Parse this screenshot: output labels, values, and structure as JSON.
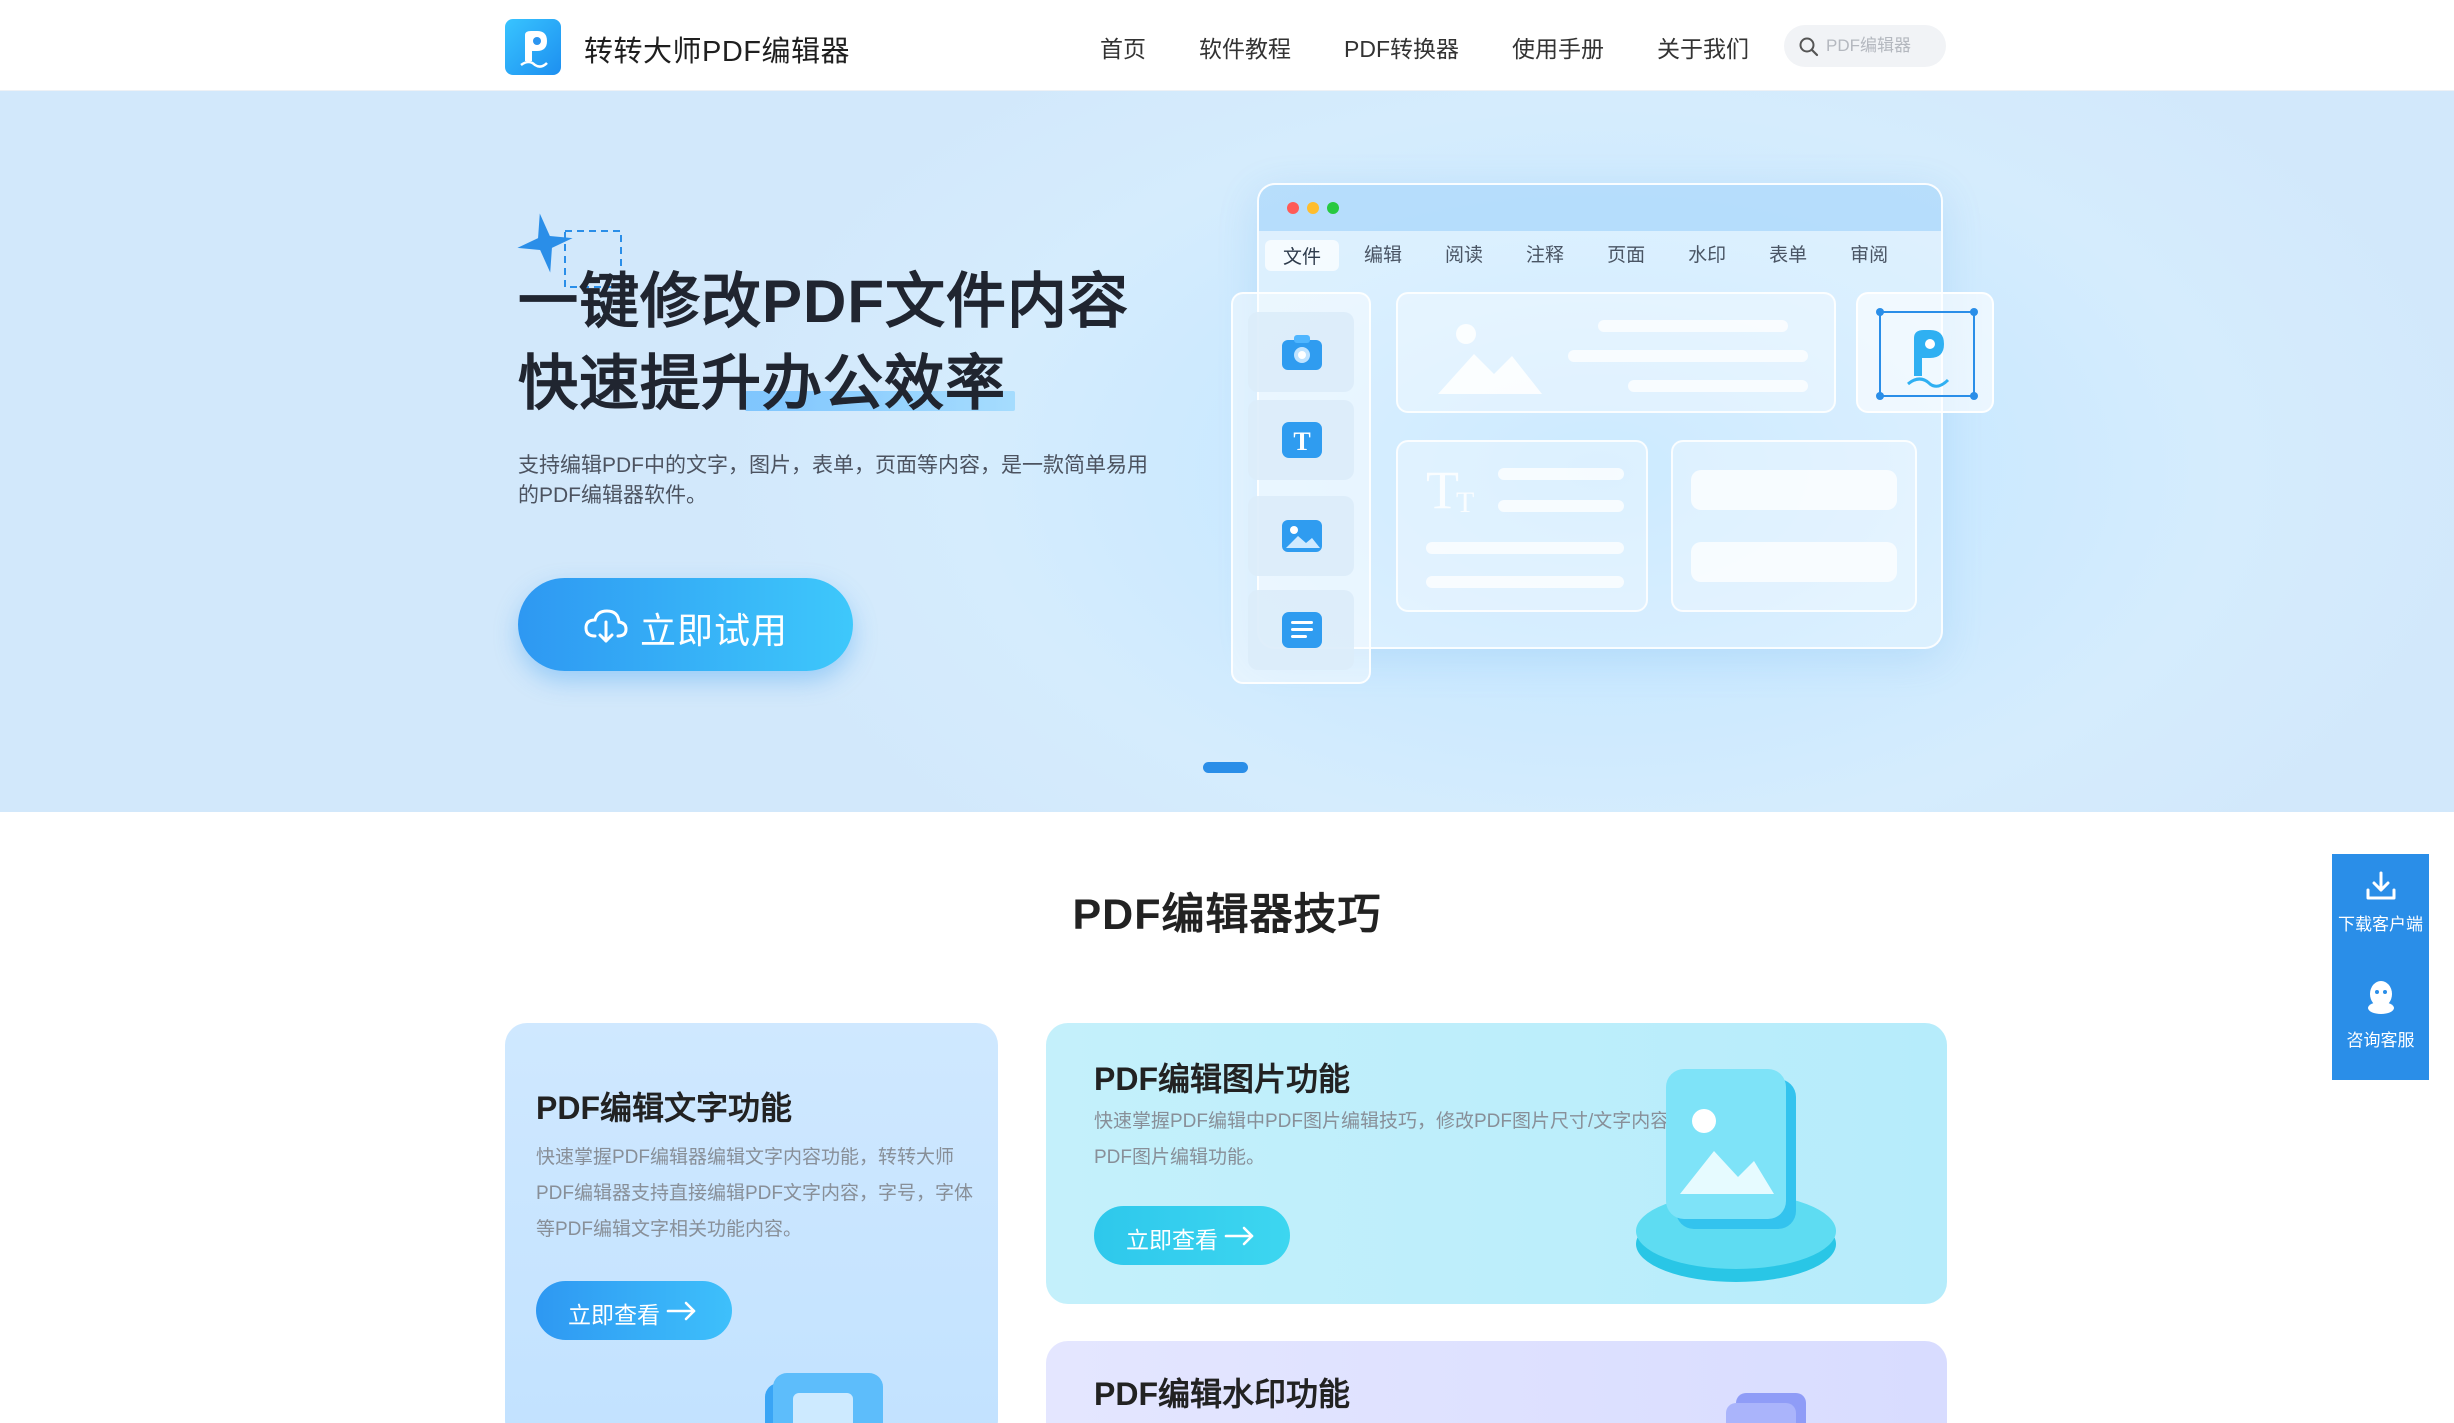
{
  "nav": {
    "brand": "转转大师PDF编辑器",
    "links": [
      "首页",
      "软件教程",
      "PDF转换器",
      "使用手册",
      "关于我们"
    ],
    "search_placeholder": "PDF编辑器"
  },
  "hero": {
    "title_line1": "一键修改PDF文件内容",
    "title_line2": "快速提升办公效率",
    "description": "支持编辑PDF中的文字，图片，表单，页面等内容，是一款简单易用的PDF编辑器软件。",
    "cta_label": "立即试用",
    "mock_tabs": [
      "文件",
      "编辑",
      "阅读",
      "注释",
      "页面",
      "水印",
      "表单",
      "审阅"
    ]
  },
  "tips": {
    "section_title": "PDF编辑器技巧",
    "cards": [
      {
        "title": "PDF编辑文字功能",
        "description": "快速掌握PDF编辑器编辑文字内容功能，转转大师PDF编辑器支持直接编辑PDF文字内容，字号，字体等PDF编辑文字相关功能内容。",
        "button": "立即查看"
      },
      {
        "title": "PDF编辑图片功能",
        "description": "快速掌握PDF编辑中PDF图片编辑技巧，修改PDF图片尺寸/文字内容等PDF图片编辑功能。",
        "button": "立即查看"
      },
      {
        "title": "PDF编辑水印功能"
      }
    ]
  },
  "float_bar": {
    "download": "下载客户端",
    "support": "咨询客服"
  },
  "colors": {
    "primary": "#2a8ee8",
    "cta_start": "#2e98f2",
    "cta_end": "#3ec8fb",
    "teal_button": "#2ec8ec"
  },
  "icons": {
    "logo": "pdf-pen-logo-icon",
    "search": "search-icon",
    "cta": "cloud-download-icon",
    "arrow": "arrow-right-icon",
    "download": "download-icon",
    "support": "qq-penguin-icon"
  }
}
